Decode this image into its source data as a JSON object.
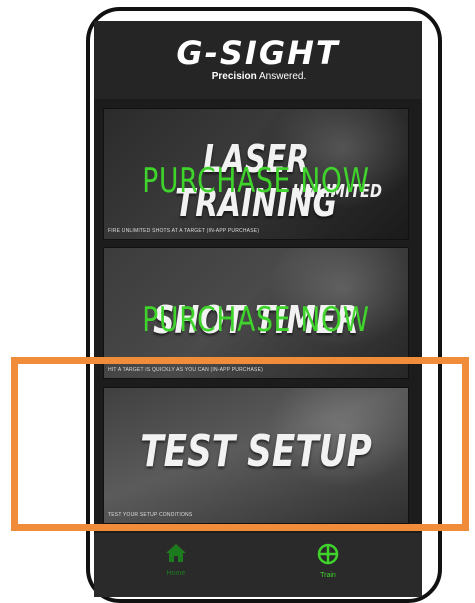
{
  "header": {
    "logo": "G-SIGHT",
    "tagline_bold": "Precision",
    "tagline_rest": " Answered."
  },
  "cards": [
    {
      "title": "LASER TRAINING",
      "subtitle": "UNLIMITED",
      "overlay": "PURCHASE NOW",
      "caption": "FIRE UNLIMITED SHOTS AT A TARGET (IN-APP PURCHASE)"
    },
    {
      "title": "SHOT TIMER",
      "overlay": "PURCHASE NOW",
      "caption": "HIT A TARGET IS QUICKLY AS YOU CAN (IN-APP PURCHASE)"
    },
    {
      "title": "TEST SETUP",
      "caption": "TEST YOUR SETUP CONDITIONS"
    }
  ],
  "nav": {
    "home_label": "Home",
    "train_label": "Train"
  },
  "colors": {
    "accent_green": "#3fd42b",
    "highlight_orange": "#f08c3a"
  }
}
